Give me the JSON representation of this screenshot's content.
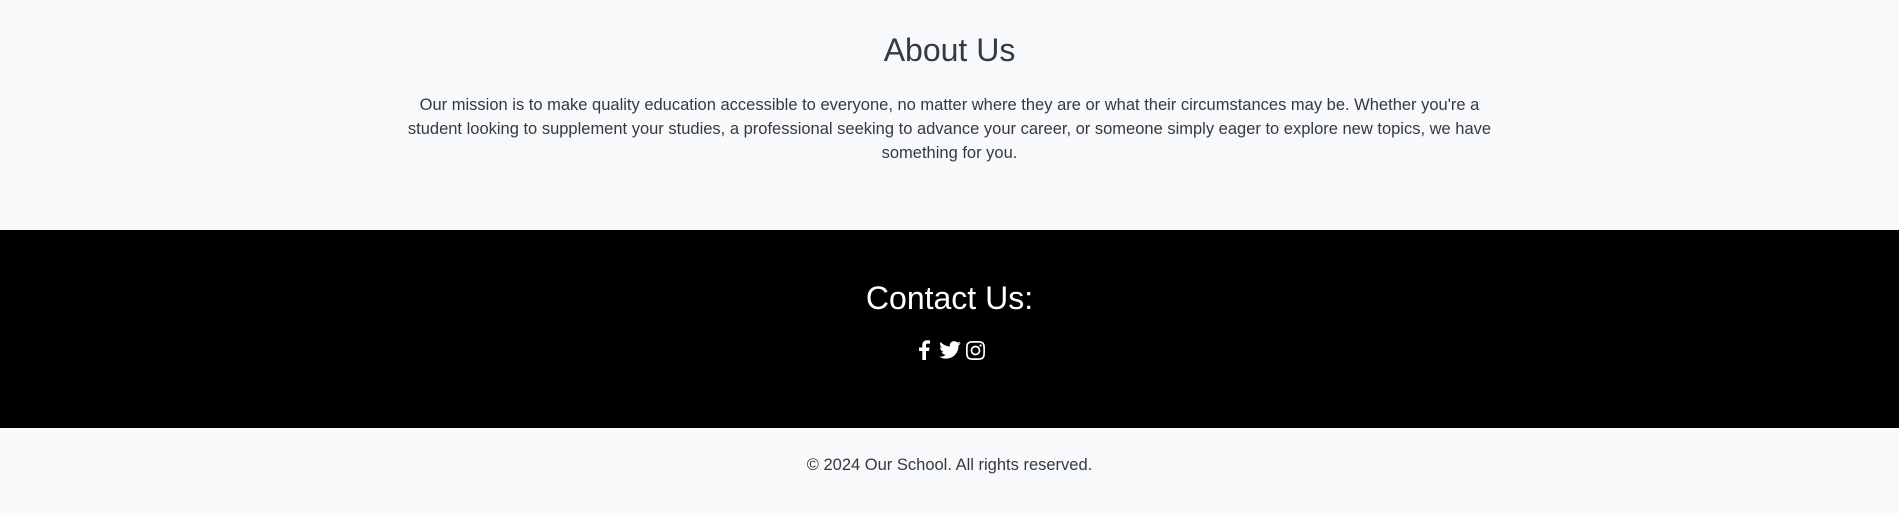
{
  "about": {
    "title": "About Us",
    "text": "Our mission is to make quality education accessible to everyone, no matter where they are or what their circumstances may be. Whether you're a student looking to supplement your studies, a professional seeking to advance your career, or someone simply eager to explore new topics, we have something for you."
  },
  "contact": {
    "title": "Contact Us:",
    "social_icons": [
      "facebook-icon",
      "twitter-icon",
      "instagram-icon"
    ]
  },
  "footer": {
    "copyright": "© 2024 Our School. All rights reserved."
  },
  "colors": {
    "light_bg": "#f8f9fa",
    "dark_bg": "#000000",
    "text": "#343a40"
  }
}
